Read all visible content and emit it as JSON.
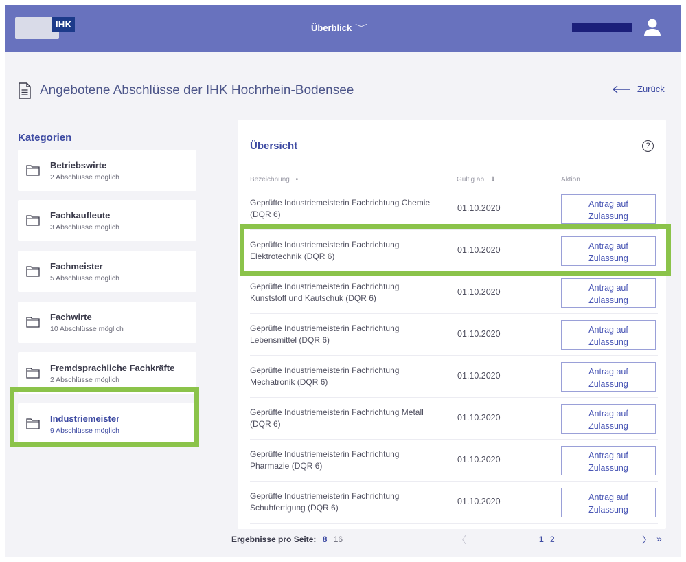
{
  "header": {
    "logo_text": "IHK",
    "nav_label": "Überblick",
    "chevron_glyph": "﹀",
    "colors": {
      "bar": "#6872be",
      "user_redaction": "#1b1f7a"
    }
  },
  "page": {
    "title": "Angebotene Abschlüsse der IHK Hochrhein-Bodensee",
    "back_label": "Zurück"
  },
  "sidebar": {
    "title": "Kategorien",
    "categories": [
      {
        "name": "Betriebswirte",
        "count": "2 Abschlüsse möglich"
      },
      {
        "name": "Fachkaufleute",
        "count": "3 Abschlüsse möglich"
      },
      {
        "name": "Fachmeister",
        "count": "5 Abschlüsse möglich"
      },
      {
        "name": "Fachwirte",
        "count": "10 Abschlüsse möglich"
      },
      {
        "name": "Fremdsprachliche Fachkräfte",
        "count": "2 Abschlüsse möglich"
      },
      {
        "name": "Industriemeister",
        "count": "9 Abschlüsse möglich"
      }
    ],
    "active": "Industriemeister"
  },
  "overview": {
    "title": "Übersicht",
    "help_glyph": "?",
    "columns": {
      "name": "Bezeichnung",
      "name_sort": "•",
      "date": "Gültig ab",
      "date_sort": "⇕",
      "action": "Aktion"
    },
    "action_line1": "Antrag auf",
    "action_line2": "Zulassung",
    "rows": [
      {
        "line1": "Geprüfte Industriemeisterin Fachrichtung Chemie",
        "line2": "(DQR 6)",
        "date": "01.10.2020"
      },
      {
        "line1": "Geprüfte Industriemeisterin Fachrichtung",
        "line2": "Elektrotechnik (DQR 6)",
        "date": "01.10.2020"
      },
      {
        "line1": "Geprüfte Industriemeisterin Fachrichtung",
        "line2": "Kunststoff und Kautschuk (DQR 6)",
        "date": "01.10.2020"
      },
      {
        "line1": "Geprüfte Industriemeisterin Fachrichtung",
        "line2": "Lebensmittel (DQR 6)",
        "date": "01.10.2020"
      },
      {
        "line1": "Geprüfte Industriemeisterin Fachrichtung",
        "line2": "Mechatronik (DQR 6)",
        "date": "01.10.2020"
      },
      {
        "line1": "Geprüfte Industriemeisterin Fachrichtung Metall",
        "line2": "(DQR 6)",
        "date": "01.10.2020"
      },
      {
        "line1": "Geprüfte Industriemeisterin Fachrichtung",
        "line2": "Pharmazie (DQR 6)",
        "date": "01.10.2020"
      },
      {
        "line1": "Geprüfte Industriemeisterin Fachrichtung",
        "line2": "Schuhfertigung (DQR 6)",
        "date": "01.10.2020"
      }
    ]
  },
  "pagination": {
    "per_page_label": "Ergebnisse pro Seite:",
    "per_page_selected": "8",
    "per_page_other": "16",
    "prev_glyph": "〈",
    "pages": [
      "1",
      "2"
    ],
    "current_page": "1",
    "next_glyph": "〉",
    "last_glyph": "»"
  },
  "highlight_color": "#8bc34a"
}
